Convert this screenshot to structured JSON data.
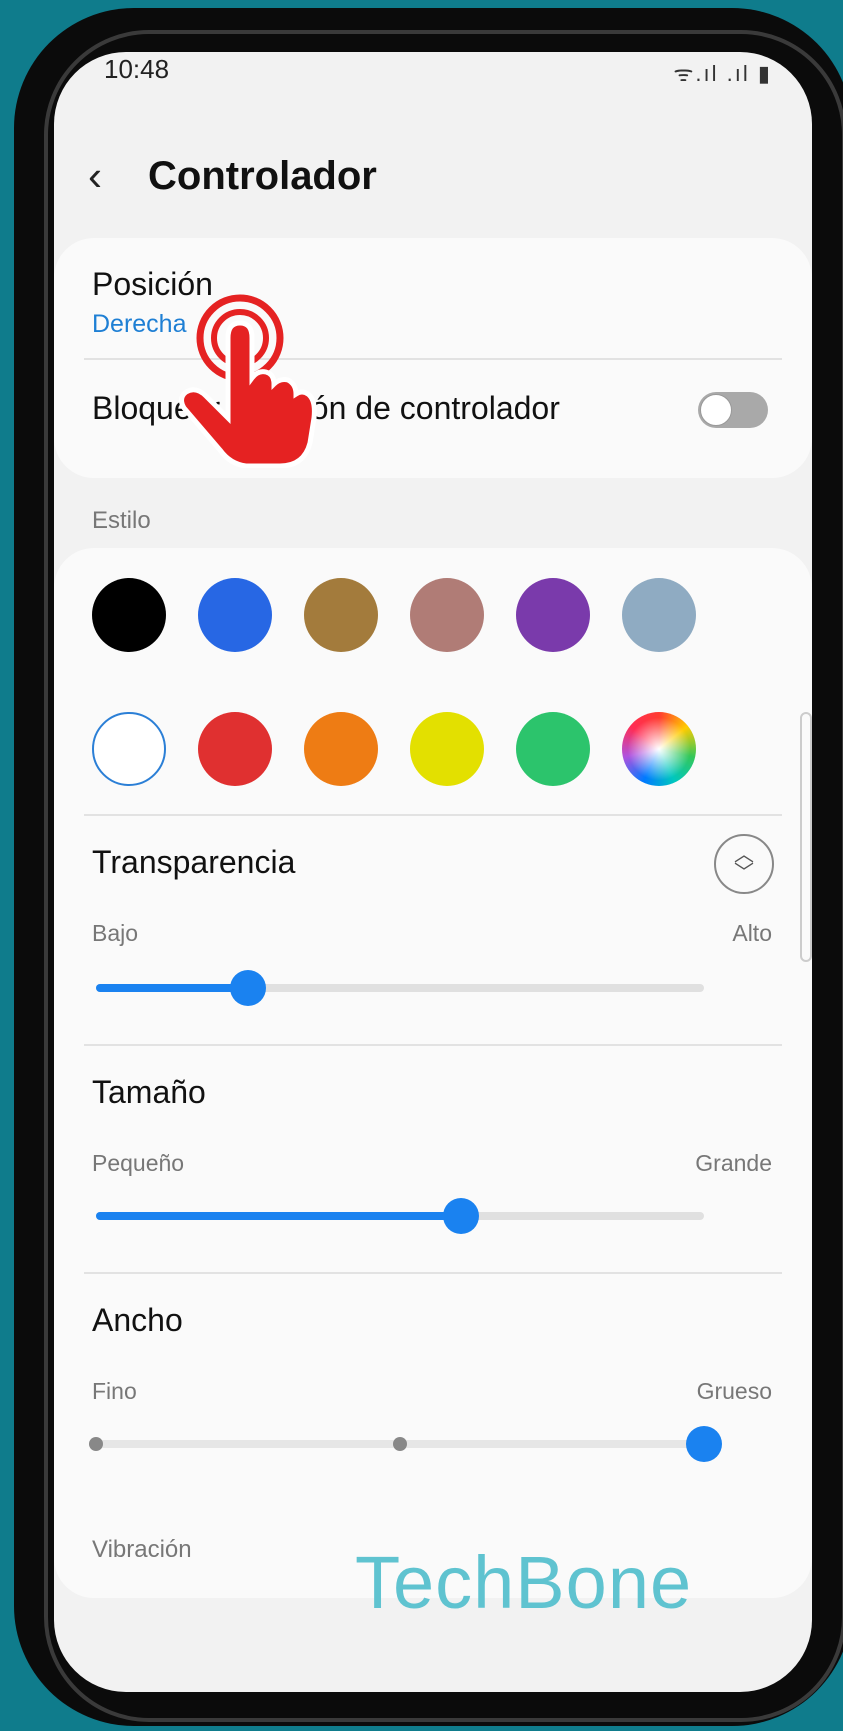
{
  "status": {
    "time": "10:48",
    "icons": "ᯤ.ıl .ıl ▮"
  },
  "header": {
    "back_icon": "‹",
    "title": "Controlador"
  },
  "position": {
    "label": "Posición",
    "value": "Derecha"
  },
  "lock": {
    "label": "Bloquear posición de controlador",
    "enabled": false
  },
  "style": {
    "label": "Estilo",
    "colors_row1": [
      "#000000",
      "#2767e4",
      "#a37b3c",
      "#b07c76",
      "#7a3aab",
      "#8fabc2"
    ],
    "colors_row2": [
      "#ffffff",
      "#e03030",
      "#ee7c14",
      "#e3e000",
      "#2cc46c",
      "conic"
    ],
    "selected_index": 6
  },
  "transparency": {
    "title": "Transparencia",
    "min": "Bajo",
    "max": "Alto",
    "value_percent": 25
  },
  "size": {
    "title": "Tamaño",
    "min": "Pequeño",
    "max": "Grande",
    "value_percent": 60
  },
  "width": {
    "title": "Ancho",
    "min": "Fino",
    "max": "Grueso",
    "steps": 3,
    "value_step": 3
  },
  "vibration": {
    "label": "Vibración"
  },
  "watermark": "TechBone"
}
